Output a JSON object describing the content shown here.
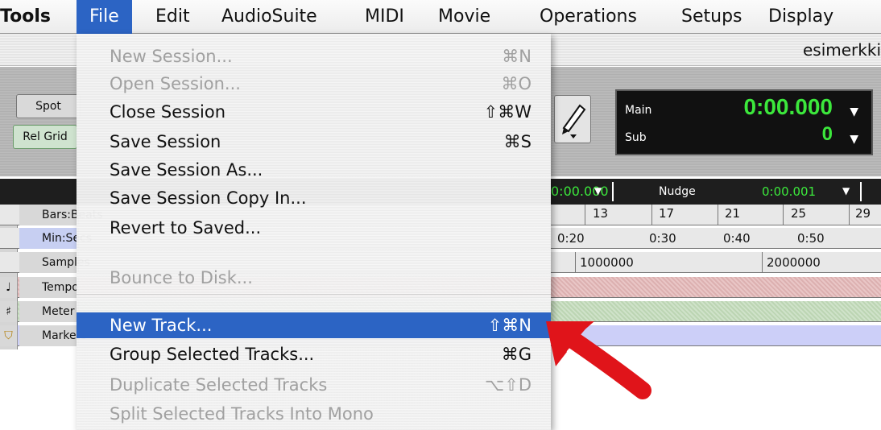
{
  "menubar": {
    "items": [
      "Tools",
      "File",
      "Edit",
      "AudioSuite",
      "MIDI",
      "Movie",
      "Operations",
      "Setups",
      "Display"
    ]
  },
  "window": {
    "title": "esimerkki"
  },
  "toolbar": {
    "spot_label": "Spot",
    "relgrid_label": "Rel Grid",
    "counter": {
      "main_label": "Main",
      "main_value": "0:00.000",
      "sub_label": "Sub",
      "sub_value": "0"
    }
  },
  "rulerbar": {
    "grid_value": "0:00.000",
    "nudge_label": "Nudge",
    "nudge_value": "0:00.001"
  },
  "rulers": {
    "bars_label": "Bars:Beats",
    "min_label": "Min:Secs",
    "samples_label": "Samples",
    "tempo_label": "Tempo",
    "meter_label": "Meter",
    "markers_label": "Markers",
    "bar_ticks": [
      "13",
      "17",
      "21",
      "25",
      "29"
    ],
    "min_ticks": [
      "0:20",
      "0:30",
      "0:40",
      "0:50"
    ],
    "sample_ticks": [
      "1000000",
      "2000000"
    ]
  },
  "file_menu": {
    "items": [
      {
        "label": "New Session...",
        "key": "⌘N",
        "enabled": false
      },
      {
        "label": "Open Session...",
        "key": "⌘O",
        "enabled": false
      },
      {
        "label": "Close Session",
        "key": "⇧⌘W",
        "enabled": true
      },
      {
        "label": "Save Session",
        "key": "⌘S",
        "enabled": true
      },
      {
        "label": "Save Session As...",
        "key": "",
        "enabled": true
      },
      {
        "label": "Save Session Copy In...",
        "key": "",
        "enabled": true
      },
      {
        "label": "Revert to Saved...",
        "key": "",
        "enabled": true
      },
      {
        "label": "Bounce to Disk...",
        "key": "",
        "enabled": false
      },
      {
        "label": "New Track...",
        "key": "⇧⌘N",
        "enabled": true,
        "highlighted": true
      },
      {
        "label": "Group Selected Tracks...",
        "key": "⌘G",
        "enabled": true
      },
      {
        "label": "Duplicate Selected Tracks",
        "key": "⌥⇧D",
        "enabled": false
      },
      {
        "label": "Split Selected Tracks Into Mono",
        "key": "",
        "enabled": false
      }
    ]
  },
  "colors": {
    "menu_highlight": "#2c64c4",
    "counter_green": "#3ce83c",
    "annotation_arrow": "#e0141a"
  }
}
